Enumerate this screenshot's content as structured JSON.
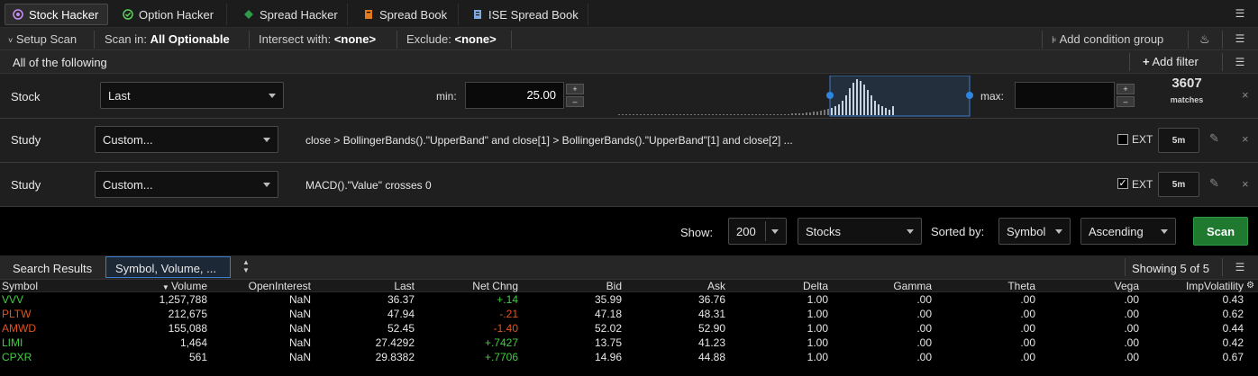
{
  "tabs": [
    {
      "label": "Stock Hacker",
      "icon": "stock-hacker-icon",
      "color": "#c58cf0",
      "active": true
    },
    {
      "label": "Option Hacker",
      "icon": "option-hacker-icon",
      "color": "#5cd05c",
      "active": false
    },
    {
      "label": "Spread Hacker",
      "icon": "spread-hacker-icon",
      "color": "#2f9a4a",
      "active": false
    },
    {
      "label": "Spread Book",
      "icon": "spread-book-icon",
      "color": "#e07b20",
      "active": false
    },
    {
      "label": "ISE Spread Book",
      "icon": "ise-spread-book-icon",
      "color": "#7fa8e0",
      "active": false
    }
  ],
  "scan_options": {
    "setup_label": "Setup Scan",
    "scan_in_label": "Scan in:",
    "scan_in_value": "All Optionable",
    "intersect_label": "Intersect with:",
    "intersect_value": "<none>",
    "exclude_label": "Exclude:",
    "exclude_value": "<none>",
    "add_condition_group": "Add condition group"
  },
  "group": {
    "label": "All of the following",
    "add_filter": "Add filter"
  },
  "filters": {
    "stock": {
      "label": "Stock",
      "field": "Last",
      "min_label": "min:",
      "min_value": "25.00",
      "max_label": "max:",
      "max_value": "",
      "matches_count": "3607",
      "matches_label": "matches"
    },
    "study1": {
      "label": "Study",
      "field": "Custom...",
      "expression": "close > BollingerBands().\"UpperBand\" and close[1] > BollingerBands().\"UpperBand\"[1] and close[2] ...",
      "ext_label": "EXT",
      "ext_checked": false,
      "aggregation": "5m"
    },
    "study2": {
      "label": "Study",
      "field": "Custom...",
      "expression": "MACD().\"Value\" crosses 0",
      "ext_label": "EXT",
      "ext_checked": true,
      "aggregation": "5m"
    }
  },
  "show_bar": {
    "show_label": "Show:",
    "show_value": "200",
    "type_value": "Stocks",
    "sorted_label": "Sorted by:",
    "sort_field": "Symbol",
    "sort_order": "Ascending",
    "scan_button": "Scan"
  },
  "results": {
    "title": "Search Results",
    "columns_set": "Symbol, Volume, ...",
    "showing": "Showing 5 of 5"
  },
  "table": {
    "columns": [
      "Symbol",
      "Volume",
      "OpenInterest",
      "Last",
      "Net Chng",
      "Bid",
      "Ask",
      "Delta",
      "Gamma",
      "Theta",
      "Vega",
      "ImpVolatility"
    ],
    "rows": [
      {
        "symbol": "VVV",
        "symbol_color": "#3fcf3f",
        "volume": "1,257,788",
        "oi": "NaN",
        "last": "36.37",
        "chng": "+.14",
        "chng_color": "#3fcf3f",
        "bid": "35.99",
        "ask": "36.76",
        "delta": "1.00",
        "gamma": ".00",
        "theta": ".00",
        "vega": ".00",
        "iv": "0.43"
      },
      {
        "symbol": "PLTW",
        "symbol_color": "#e0541e",
        "volume": "212,675",
        "oi": "NaN",
        "last": "47.94",
        "chng": "-.21",
        "chng_color": "#e0541e",
        "bid": "47.18",
        "ask": "48.31",
        "delta": "1.00",
        "gamma": ".00",
        "theta": ".00",
        "vega": ".00",
        "iv": "0.62"
      },
      {
        "symbol": "AMWD",
        "symbol_color": "#e0541e",
        "volume": "155,088",
        "oi": "NaN",
        "last": "52.45",
        "chng": "-1.40",
        "chng_color": "#e0541e",
        "bid": "52.02",
        "ask": "52.90",
        "delta": "1.00",
        "gamma": ".00",
        "theta": ".00",
        "vega": ".00",
        "iv": "0.44"
      },
      {
        "symbol": "LIMI",
        "symbol_color": "#3fcf3f",
        "volume": "1,464",
        "oi": "NaN",
        "last": "27.4292",
        "chng": "+.7427",
        "chng_color": "#3fcf3f",
        "bid": "13.75",
        "ask": "41.23",
        "delta": "1.00",
        "gamma": ".00",
        "theta": ".00",
        "vega": ".00",
        "iv": "0.42"
      },
      {
        "symbol": "CPXR",
        "symbol_color": "#3fcf3f",
        "volume": "561",
        "oi": "NaN",
        "last": "29.8382",
        "chng": "+.7706",
        "chng_color": "#3fcf3f",
        "bid": "14.96",
        "ask": "44.88",
        "delta": "1.00",
        "gamma": ".00",
        "theta": ".00",
        "vega": ".00",
        "iv": "0.67"
      }
    ]
  }
}
